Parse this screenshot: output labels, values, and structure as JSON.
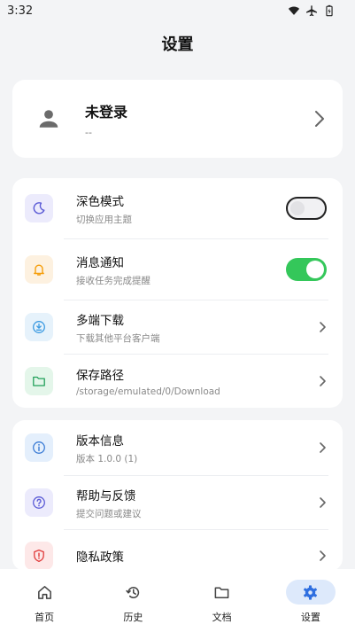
{
  "status_bar": {
    "time": "3:32"
  },
  "header": {
    "title": "设置"
  },
  "profile": {
    "name": "未登录",
    "sub": "--"
  },
  "settings": {
    "items": [
      {
        "title": "深色模式",
        "sub": "切换应用主题",
        "icon": "moon-icon",
        "toggle": false
      },
      {
        "title": "消息通知",
        "sub": "接收任务完成提醒",
        "icon": "bell-icon",
        "toggle": true
      },
      {
        "title": "多端下载",
        "sub": "下载其他平台客户端",
        "icon": "download-icon"
      },
      {
        "title": "保存路径",
        "sub": "/storage/emulated/0/Download",
        "icon": "folder-icon"
      }
    ]
  },
  "about": {
    "items": [
      {
        "title": "版本信息",
        "sub": "版本 1.0.0 (1)",
        "icon": "info-icon"
      },
      {
        "title": "帮助与反馈",
        "sub": "提交问题或建议",
        "icon": "help-icon"
      },
      {
        "title": "隐私政策",
        "icon": "shield-icon"
      }
    ]
  },
  "nav": {
    "items": [
      {
        "label": "首页",
        "icon": "home-icon"
      },
      {
        "label": "历史",
        "icon": "history-icon"
      },
      {
        "label": "文档",
        "icon": "folder-icon"
      },
      {
        "label": "设置",
        "icon": "gear-icon",
        "active": true
      }
    ]
  },
  "colors": {
    "accent": "#2f6fe0",
    "toggle_on": "#34c75a",
    "moon": "#5b5bd6",
    "bell": "#f59e0b",
    "download": "#3b9ae1",
    "folder": "#22a05a",
    "info": "#3a7bd5",
    "help": "#5b5bd6",
    "shield": "#e03a3a"
  }
}
